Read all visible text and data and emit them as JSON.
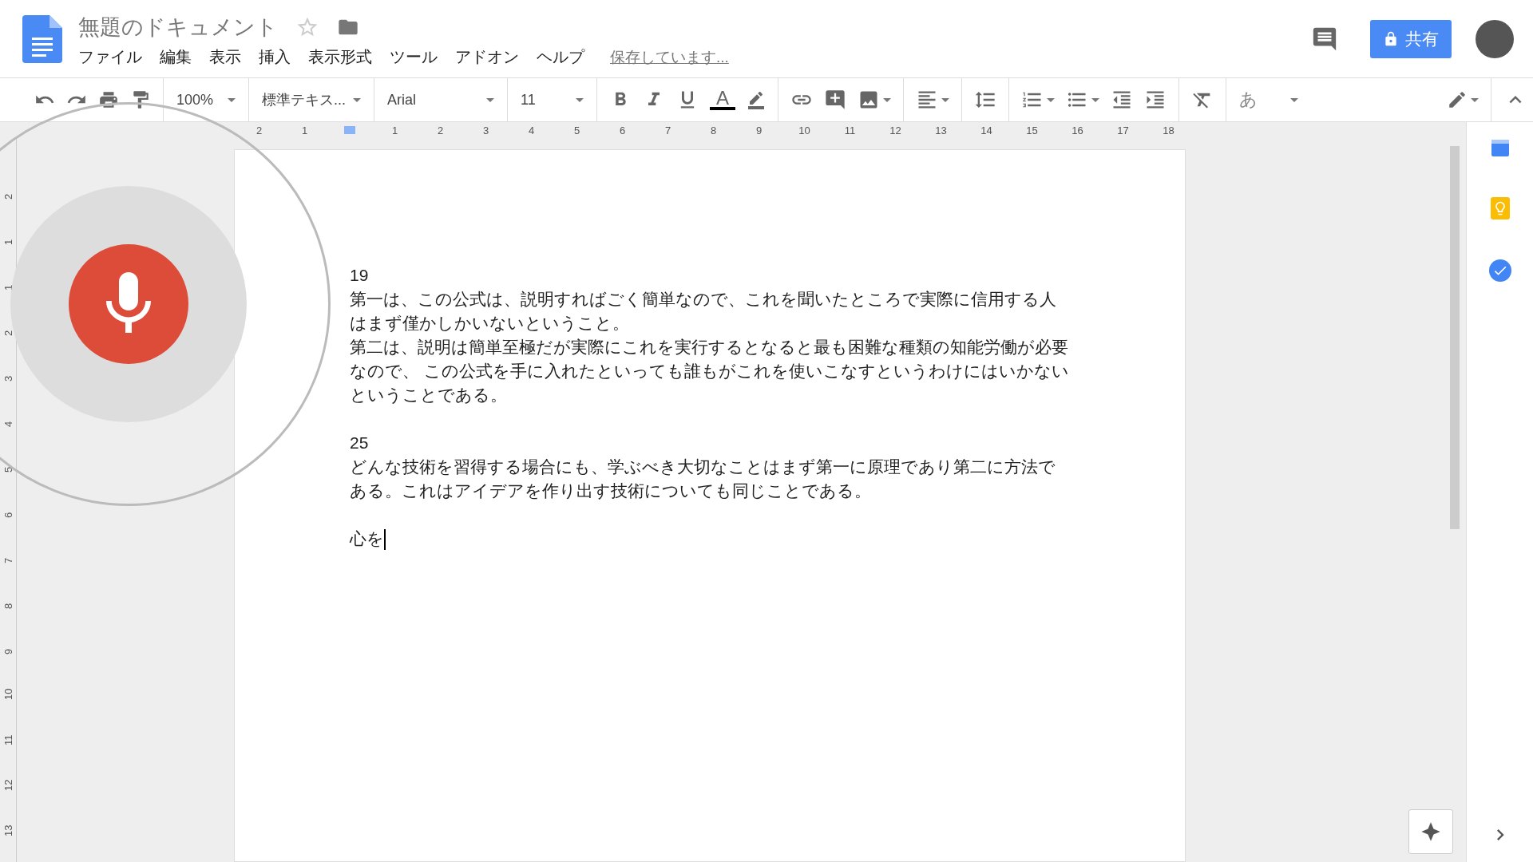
{
  "header": {
    "title": "無題のドキュメント",
    "starred": false,
    "menus": [
      "ファイル",
      "編集",
      "表示",
      "挿入",
      "表示形式",
      "ツール",
      "アドオン",
      "ヘルプ"
    ],
    "save_status": "保存しています...",
    "share_label": "共有"
  },
  "toolbar": {
    "text_color_label": "A",
    "zoom": "100%",
    "style": "標準テキス...",
    "font": "Arial",
    "size": "11",
    "input_tool": "あ"
  },
  "ruler": {
    "left_marks": [
      "2",
      "1"
    ],
    "right_marks": [
      "1",
      "2",
      "3",
      "4",
      "5",
      "6",
      "7",
      "8",
      "9",
      "10",
      "11",
      "12",
      "13",
      "14",
      "15",
      "16",
      "17",
      "18"
    ],
    "vertical_marks": [
      "2",
      "1",
      "1",
      "2",
      "3",
      "4",
      "5",
      "6",
      "7",
      "8",
      "9",
      "10",
      "11",
      "12",
      "13"
    ]
  },
  "document": {
    "sections": [
      {
        "paragraphs": [
          {
            "text": "19"
          },
          {
            "text": "第一は、この公式は、説明すればごく簡単なので、これを聞いたところで実際に信用する人はまず僅かしかいないということ。"
          },
          {
            "text": "第二は、説明は簡単至極だが実際にこれを実行するとなると最も困難な種類の知能労働が必要なので、 この公式を手に入れたといっても誰もがこれを使いこなすというわけにはいかないということである。"
          }
        ]
      },
      {
        "paragraphs": [
          {
            "text": "25"
          },
          {
            "text": "どんな技術を習得する場合にも、学ぶべき大切なことはまず第一に原理であり第二に方法である。これはアイデアを作り出す技術についても同じことである。"
          }
        ]
      },
      {
        "paragraphs": [
          {
            "text": "心を"
          }
        ]
      }
    ]
  },
  "voice_typing": {
    "listening": true
  }
}
